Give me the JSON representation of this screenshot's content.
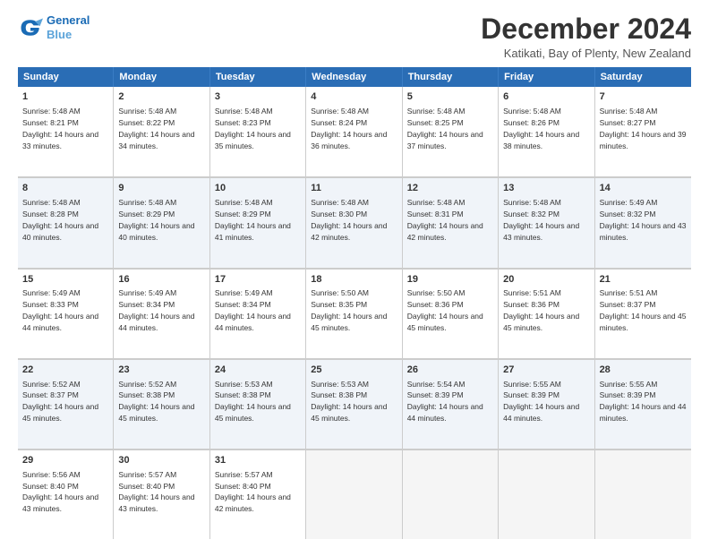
{
  "header": {
    "logo_line1": "General",
    "logo_line2": "Blue",
    "title": "December 2024",
    "subtitle": "Katikati, Bay of Plenty, New Zealand"
  },
  "days": [
    "Sunday",
    "Monday",
    "Tuesday",
    "Wednesday",
    "Thursday",
    "Friday",
    "Saturday"
  ],
  "weeks": [
    [
      {
        "day": "1",
        "sunrise": "5:48 AM",
        "sunset": "8:21 PM",
        "daylight": "14 hours and 33 minutes."
      },
      {
        "day": "2",
        "sunrise": "5:48 AM",
        "sunset": "8:22 PM",
        "daylight": "14 hours and 34 minutes."
      },
      {
        "day": "3",
        "sunrise": "5:48 AM",
        "sunset": "8:23 PM",
        "daylight": "14 hours and 35 minutes."
      },
      {
        "day": "4",
        "sunrise": "5:48 AM",
        "sunset": "8:24 PM",
        "daylight": "14 hours and 36 minutes."
      },
      {
        "day": "5",
        "sunrise": "5:48 AM",
        "sunset": "8:25 PM",
        "daylight": "14 hours and 37 minutes."
      },
      {
        "day": "6",
        "sunrise": "5:48 AM",
        "sunset": "8:26 PM",
        "daylight": "14 hours and 38 minutes."
      },
      {
        "day": "7",
        "sunrise": "5:48 AM",
        "sunset": "8:27 PM",
        "daylight": "14 hours and 39 minutes."
      }
    ],
    [
      {
        "day": "8",
        "sunrise": "5:48 AM",
        "sunset": "8:28 PM",
        "daylight": "14 hours and 40 minutes."
      },
      {
        "day": "9",
        "sunrise": "5:48 AM",
        "sunset": "8:29 PM",
        "daylight": "14 hours and 40 minutes."
      },
      {
        "day": "10",
        "sunrise": "5:48 AM",
        "sunset": "8:29 PM",
        "daylight": "14 hours and 41 minutes."
      },
      {
        "day": "11",
        "sunrise": "5:48 AM",
        "sunset": "8:30 PM",
        "daylight": "14 hours and 42 minutes."
      },
      {
        "day": "12",
        "sunrise": "5:48 AM",
        "sunset": "8:31 PM",
        "daylight": "14 hours and 42 minutes."
      },
      {
        "day": "13",
        "sunrise": "5:48 AM",
        "sunset": "8:32 PM",
        "daylight": "14 hours and 43 minutes."
      },
      {
        "day": "14",
        "sunrise": "5:49 AM",
        "sunset": "8:32 PM",
        "daylight": "14 hours and 43 minutes."
      }
    ],
    [
      {
        "day": "15",
        "sunrise": "5:49 AM",
        "sunset": "8:33 PM",
        "daylight": "14 hours and 44 minutes."
      },
      {
        "day": "16",
        "sunrise": "5:49 AM",
        "sunset": "8:34 PM",
        "daylight": "14 hours and 44 minutes."
      },
      {
        "day": "17",
        "sunrise": "5:49 AM",
        "sunset": "8:34 PM",
        "daylight": "14 hours and 44 minutes."
      },
      {
        "day": "18",
        "sunrise": "5:50 AM",
        "sunset": "8:35 PM",
        "daylight": "14 hours and 45 minutes."
      },
      {
        "day": "19",
        "sunrise": "5:50 AM",
        "sunset": "8:36 PM",
        "daylight": "14 hours and 45 minutes."
      },
      {
        "day": "20",
        "sunrise": "5:51 AM",
        "sunset": "8:36 PM",
        "daylight": "14 hours and 45 minutes."
      },
      {
        "day": "21",
        "sunrise": "5:51 AM",
        "sunset": "8:37 PM",
        "daylight": "14 hours and 45 minutes."
      }
    ],
    [
      {
        "day": "22",
        "sunrise": "5:52 AM",
        "sunset": "8:37 PM",
        "daylight": "14 hours and 45 minutes."
      },
      {
        "day": "23",
        "sunrise": "5:52 AM",
        "sunset": "8:38 PM",
        "daylight": "14 hours and 45 minutes."
      },
      {
        "day": "24",
        "sunrise": "5:53 AM",
        "sunset": "8:38 PM",
        "daylight": "14 hours and 45 minutes."
      },
      {
        "day": "25",
        "sunrise": "5:53 AM",
        "sunset": "8:38 PM",
        "daylight": "14 hours and 45 minutes."
      },
      {
        "day": "26",
        "sunrise": "5:54 AM",
        "sunset": "8:39 PM",
        "daylight": "14 hours and 44 minutes."
      },
      {
        "day": "27",
        "sunrise": "5:55 AM",
        "sunset": "8:39 PM",
        "daylight": "14 hours and 44 minutes."
      },
      {
        "day": "28",
        "sunrise": "5:55 AM",
        "sunset": "8:39 PM",
        "daylight": "14 hours and 44 minutes."
      }
    ],
    [
      {
        "day": "29",
        "sunrise": "5:56 AM",
        "sunset": "8:40 PM",
        "daylight": "14 hours and 43 minutes."
      },
      {
        "day": "30",
        "sunrise": "5:57 AM",
        "sunset": "8:40 PM",
        "daylight": "14 hours and 43 minutes."
      },
      {
        "day": "31",
        "sunrise": "5:57 AM",
        "sunset": "8:40 PM",
        "daylight": "14 hours and 42 minutes."
      },
      null,
      null,
      null,
      null
    ]
  ]
}
